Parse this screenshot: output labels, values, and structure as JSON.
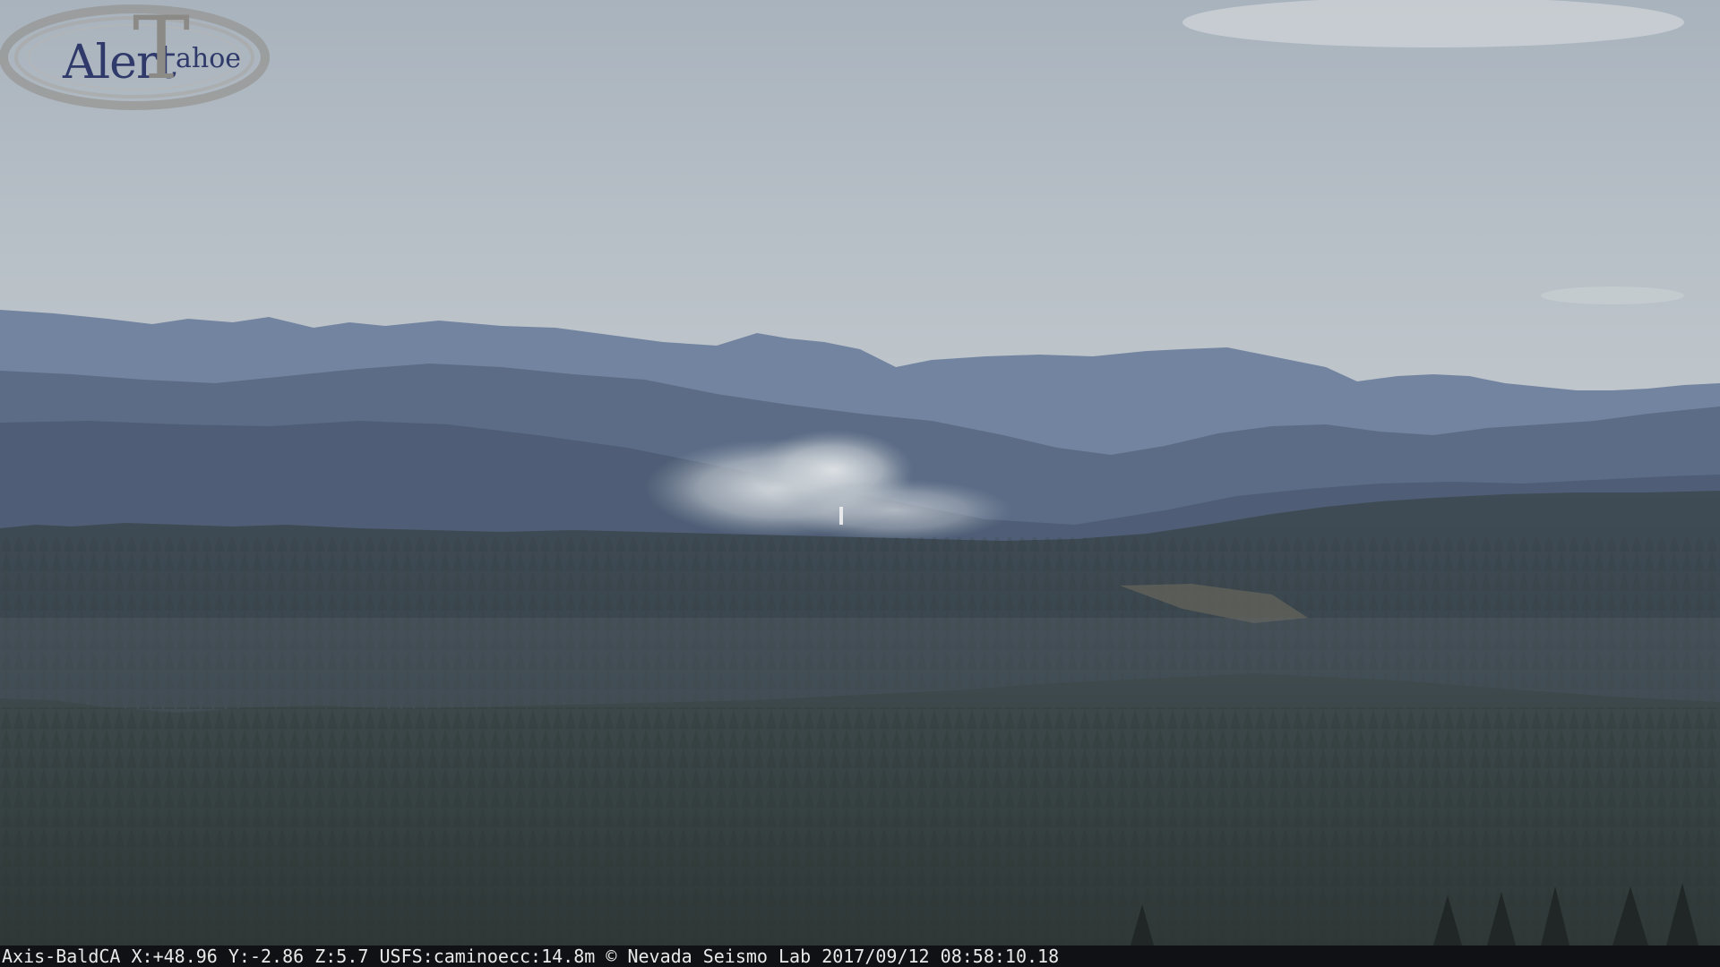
{
  "logo": {
    "word": "Alert",
    "big_letter": "T",
    "rest": "ahoe"
  },
  "status": {
    "camera": "Axis-BaldCA",
    "x": "X:+48.96",
    "y": "Y:-2.86",
    "z": "Z:5.7",
    "usfs": "USFS:caminoecc:14.8m",
    "credit": "© Nevada Seismo Lab",
    "date": "2017/09/12",
    "time": "08:58:10.18"
  },
  "colors": {
    "sky": "#b7c0c8",
    "far_ridge": "#6f7f97",
    "mid_ridge": "#566680",
    "forest": "#3c474c",
    "smoke": "#c9cfd4",
    "status_bar": "#0f1114"
  }
}
